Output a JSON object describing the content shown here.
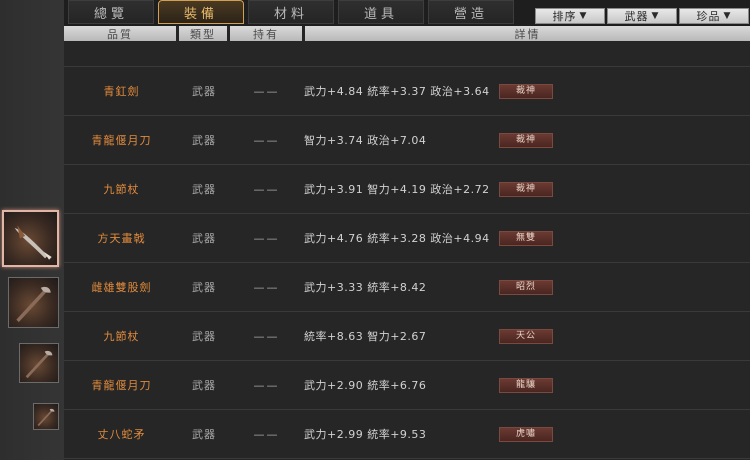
{
  "tabs": [
    {
      "label": "總覽",
      "active": false
    },
    {
      "label": "裝備",
      "active": true
    },
    {
      "label": "材料",
      "active": false
    },
    {
      "label": "道具",
      "active": false
    },
    {
      "label": "營造",
      "active": false
    }
  ],
  "filters": [
    {
      "label": "排序"
    },
    {
      "label": "武器"
    },
    {
      "label": "珍品"
    }
  ],
  "columns": {
    "quality": "品質",
    "type": "類型",
    "hold": "持有",
    "detail": "詳情"
  },
  "partial_row": {
    "name": "",
    "type": "類型"
  },
  "rows": [
    {
      "name": "青釭劍",
      "type": "武器",
      "hold": "——",
      "stats": "武力+4.84  統率+3.37  政治+3.64",
      "badge": "裁神"
    },
    {
      "name": "青龍偃月刀",
      "type": "武器",
      "hold": "——",
      "stats": "智力+3.74  政治+7.04",
      "badge": "裁神"
    },
    {
      "name": "九節杖",
      "type": "武器",
      "hold": "——",
      "stats": "武力+3.91  智力+4.19  政治+2.72",
      "badge": "裁神"
    },
    {
      "name": "方天畫戟",
      "type": "武器",
      "hold": "——",
      "stats": "武力+4.76  統率+3.28  政治+4.94",
      "badge": "無雙"
    },
    {
      "name": "雌雄雙股劍",
      "type": "武器",
      "hold": "——",
      "stats": "武力+3.33  統率+8.42",
      "badge": "昭烈"
    },
    {
      "name": "九節杖",
      "type": "武器",
      "hold": "——",
      "stats": "統率+8.63  智力+2.67",
      "badge": "天公"
    },
    {
      "name": "青龍偃月刀",
      "type": "武器",
      "hold": "——",
      "stats": "武力+2.90  統率+6.76",
      "badge": "龍驤"
    },
    {
      "name": "丈八蛇矛",
      "type": "武器",
      "hold": "——",
      "stats": "武力+2.99  統率+9.53",
      "badge": "虎嘯"
    }
  ],
  "thumbnails": [
    {
      "icon": "halberd-icon",
      "selected": true
    },
    {
      "icon": "halberd-icon",
      "selected": false
    },
    {
      "icon": "halberd-icon",
      "selected": false
    },
    {
      "icon": "halberd-icon",
      "selected": false
    }
  ]
}
